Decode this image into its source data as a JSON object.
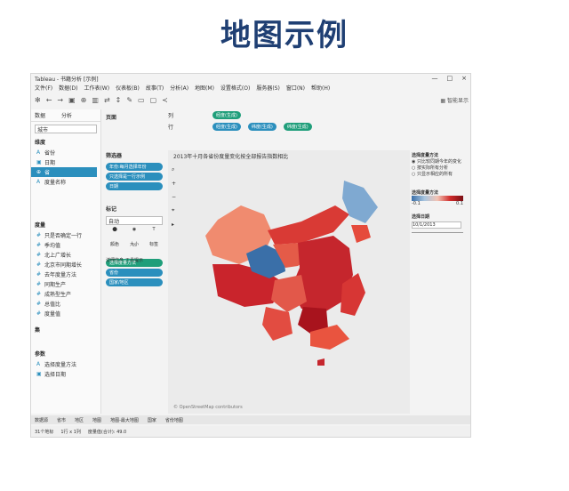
{
  "slide": {
    "title": "地图示例"
  },
  "window": {
    "app_name": "Tableau - 书籍分析 [示例]",
    "controls": [
      "—",
      "□",
      "×"
    ]
  },
  "menu": [
    "文件(F)",
    "数据(D)",
    "工作表(W)",
    "仪表板(B)",
    "故事(T)",
    "分析(A)",
    "地图(M)",
    "设置格式(O)",
    "服务器(S)",
    "窗口(N)",
    "帮助(H)"
  ],
  "toolbar": {
    "show_me": "智能显示"
  },
  "left_panel": {
    "data_tab": "数据",
    "analytics_tab": "分析",
    "datasource": "城市",
    "dimensions_head": "维度",
    "dimensions": [
      "省份",
      "日期",
      "省",
      "度量名称"
    ],
    "measures_head": "度量",
    "measures": [
      "只是否确定一行",
      "季均值",
      "北上广增长",
      "北京市同期增长",
      "去年度量方法",
      "同期生产",
      "成熟型生产",
      "总值比",
      "度量值"
    ],
    "sets_head": "集",
    "params_head": "参数",
    "params": [
      "选择度量方法",
      "选择日期"
    ]
  },
  "pages_card": {
    "title": "页面"
  },
  "filters_card": {
    "title": "筛选器",
    "items": [
      "年份:每月选择年份",
      "只选择是一行示例",
      "日期"
    ]
  },
  "marks_card": {
    "title": "标记",
    "type": "自动",
    "buttons": [
      "颜色",
      "大小",
      "标签",
      "详细信息",
      "工具提示"
    ],
    "pills": [
      "选择度量方法",
      "省份",
      "国家/地区"
    ]
  },
  "shelves": {
    "columns_label": "列",
    "rows_label": "行",
    "columns": [
      "经度(生成)"
    ],
    "rows": [
      "经度(生成)",
      "纬度(生成)",
      "纬度(生成)"
    ]
  },
  "viz": {
    "title": "2013年十月各省份度量变化按全部报告指数相比",
    "copyright": "© OpenStreetMap contributors"
  },
  "right_panel": {
    "param1_title": "选择度量方法",
    "param1_options": [
      "只比较同期今年的变化",
      "按实际所有分析",
      "只显示相应的所有"
    ],
    "legend_title": "选择度量方法",
    "legend_min": "-0.1",
    "legend_max": "0.1",
    "date_title": "选择日期",
    "date_value": "10/1/2013"
  },
  "tabs": [
    "数据源",
    "省市",
    "地区",
    "地图",
    "地图-最大地图",
    "国家",
    "省份地图"
  ],
  "status": [
    "31个地标",
    "1行 x 1列",
    "度量值(合计): 49.0"
  ],
  "colors": {
    "title": "#1f3f73",
    "pill_blue": "#2b8fbd",
    "pill_green": "#1f9e7a"
  }
}
